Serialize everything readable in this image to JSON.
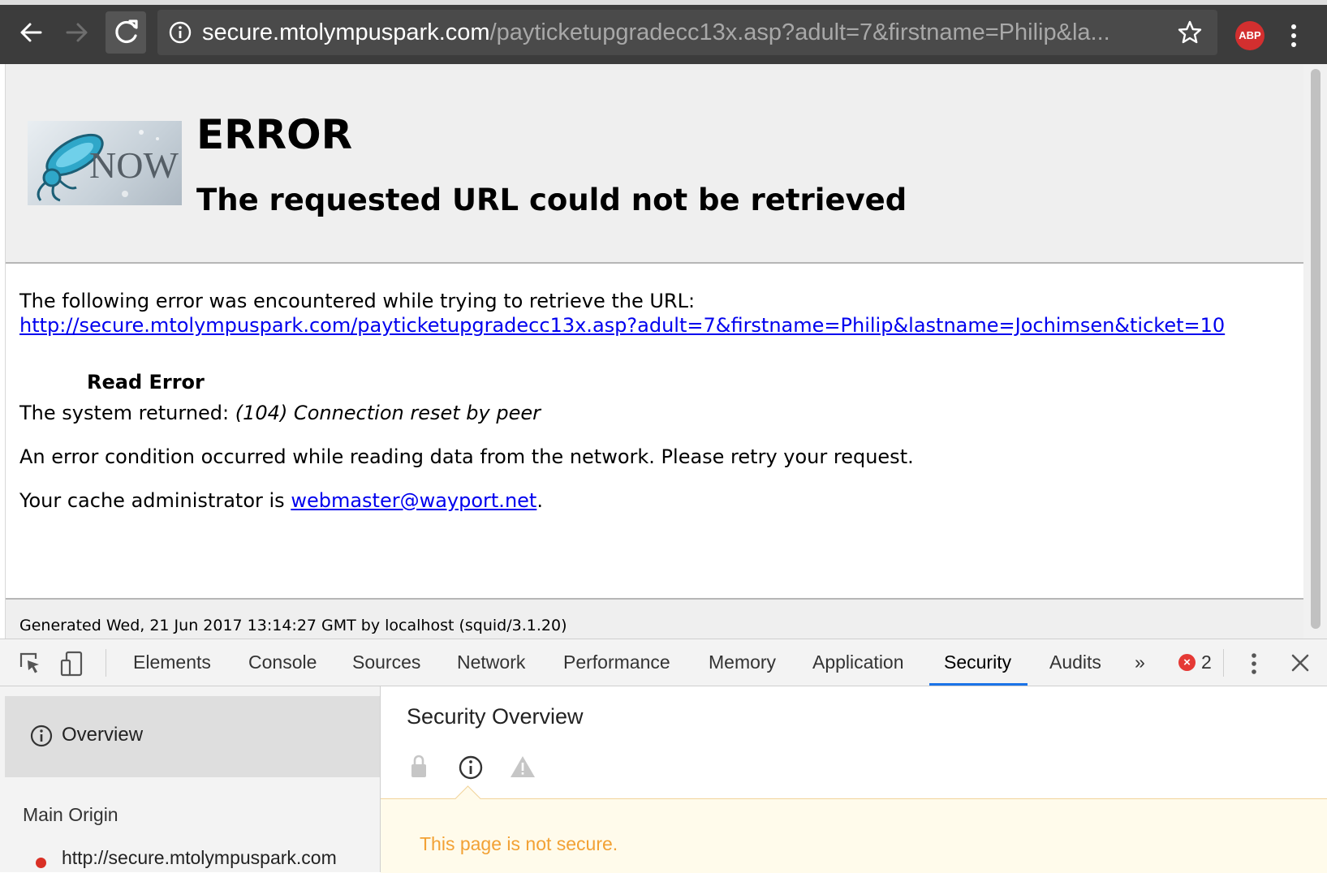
{
  "browser": {
    "url_host": "secure.mtolympuspark.com",
    "url_path": "/payticketupgradecc13x.asp?adult=7&firstname=Philip&la...",
    "extension_badge": "ABP"
  },
  "error_page": {
    "logo_text": "NOW",
    "title": "ERROR",
    "subtitle": "The requested URL could not be retrieved",
    "intro": "The following error was encountered while trying to retrieve the URL:",
    "requested_url": "http://secure.mtolympuspark.com/payticketupgradecc13x.asp?adult=7&firstname=Philip&lastname=Jochimsen&ticket=10",
    "error_name": "Read Error",
    "system_returned_label": "The system returned: ",
    "system_returned_value": "(104) Connection reset by peer",
    "description": "An error condition occurred while reading data from the network. Please retry your request.",
    "admin_label": "Your cache administrator is ",
    "admin_email": "webmaster@wayport.net",
    "admin_suffix": ".",
    "footer": "Generated Wed, 21 Jun 2017 13:14:27 GMT by localhost (squid/3.1.20)"
  },
  "devtools": {
    "tabs": [
      "Elements",
      "Console",
      "Sources",
      "Network",
      "Performance",
      "Memory",
      "Application",
      "Security",
      "Audits"
    ],
    "active_tab": "Security",
    "more_tabs": "»",
    "error_count": "2",
    "sidebar": {
      "overview_label": "Overview",
      "main_origin_header": "Main Origin",
      "origin_url": "http://secure.mtolympuspark.com"
    },
    "main": {
      "title": "Security Overview",
      "notice": "This page is not secure."
    },
    "colors": {
      "active_tab_underline": "#1a73e8",
      "notice_text": "#f2a134",
      "origin_dot": "#d93025",
      "error_badge": "#e53935"
    }
  }
}
